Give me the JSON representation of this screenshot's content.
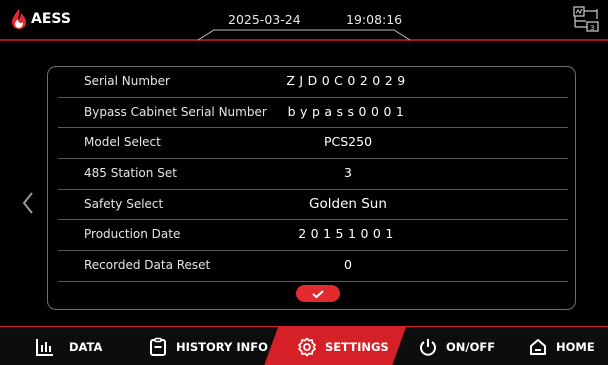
{
  "header": {
    "brand": "AESS",
    "date": "2025-03-24",
    "time": "19:08:16",
    "accent_color": "#d62027"
  },
  "settings": {
    "rows": [
      {
        "label": "Serial Number",
        "value": "ZJD0C02029"
      },
      {
        "label": "Bypass Cabinet Serial Number",
        "value": "bypass0001"
      },
      {
        "label": "Model Select",
        "value": "PCS250"
      },
      {
        "label": "485 Station Set",
        "value": "3"
      },
      {
        "label": "Safety Select",
        "value": "Golden Sun"
      },
      {
        "label": "Production Date",
        "value": "20151001"
      },
      {
        "label": "Recorded Data Reset",
        "value": "0"
      }
    ],
    "confirm_icon": "check-icon",
    "prev_icon": "chevron-left-icon"
  },
  "nav": {
    "items": [
      {
        "label": "DATA",
        "icon": "bar-chart-icon",
        "active": false
      },
      {
        "label": "HISTORY INFO",
        "icon": "clipboard-icon",
        "active": false
      },
      {
        "label": "SETTINGS",
        "icon": "gear-icon",
        "active": true
      },
      {
        "label": "ON/OFF",
        "icon": "power-icon",
        "active": false
      },
      {
        "label": "HOME",
        "icon": "home-icon",
        "active": false
      }
    ]
  }
}
